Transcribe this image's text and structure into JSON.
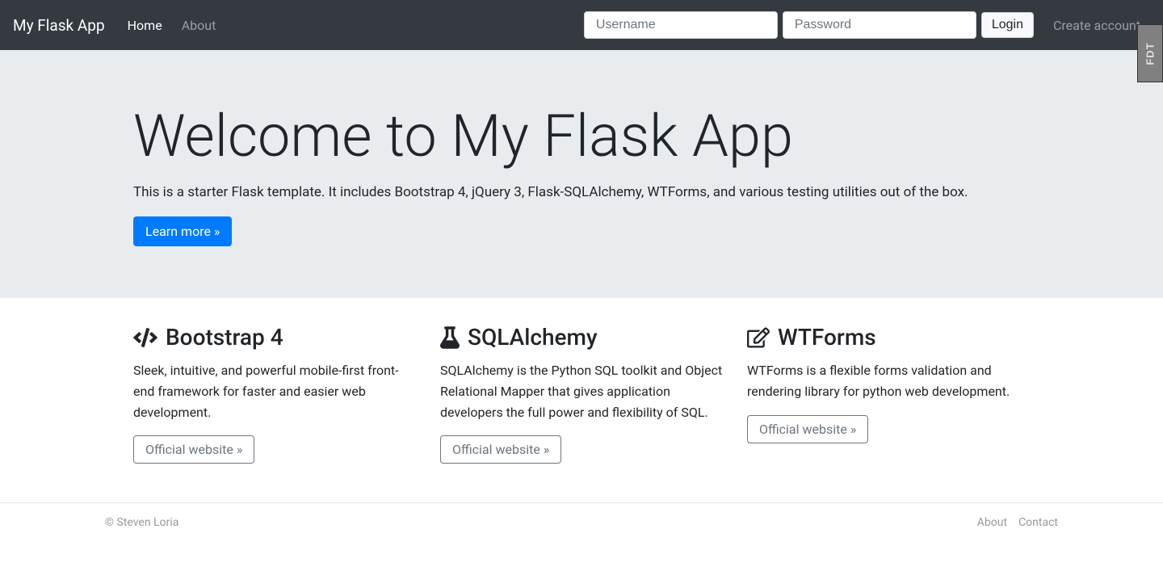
{
  "navbar": {
    "brand": "My Flask App",
    "home": "Home",
    "about": "About",
    "username_placeholder": "Username",
    "password_placeholder": "Password",
    "login": "Login",
    "create_account": "Create account"
  },
  "hero": {
    "title": "Welcome to My Flask App",
    "description": "This is a starter Flask template. It includes Bootstrap 4, jQuery 3, Flask-SQLAlchemy, WTForms, and various testing utilities out of the box.",
    "button": "Learn more »"
  },
  "features": [
    {
      "title": "Bootstrap 4",
      "description": "Sleek, intuitive, and powerful mobile-first front-end framework for faster and easier web development.",
      "button": "Official website »"
    },
    {
      "title": "SQLAlchemy",
      "description": "SQLAlchemy is the Python SQL toolkit and Object Relational Mapper that gives application developers the full power and flexibility of SQL.",
      "button": "Official website »"
    },
    {
      "title": "WTForms",
      "description": "WTForms is a flexible forms validation and rendering library for python web development.",
      "button": "Official website »"
    }
  ],
  "footer": {
    "copyright": "© Steven Loria",
    "about": "About",
    "contact": "Contact"
  },
  "fdt": "FDT"
}
